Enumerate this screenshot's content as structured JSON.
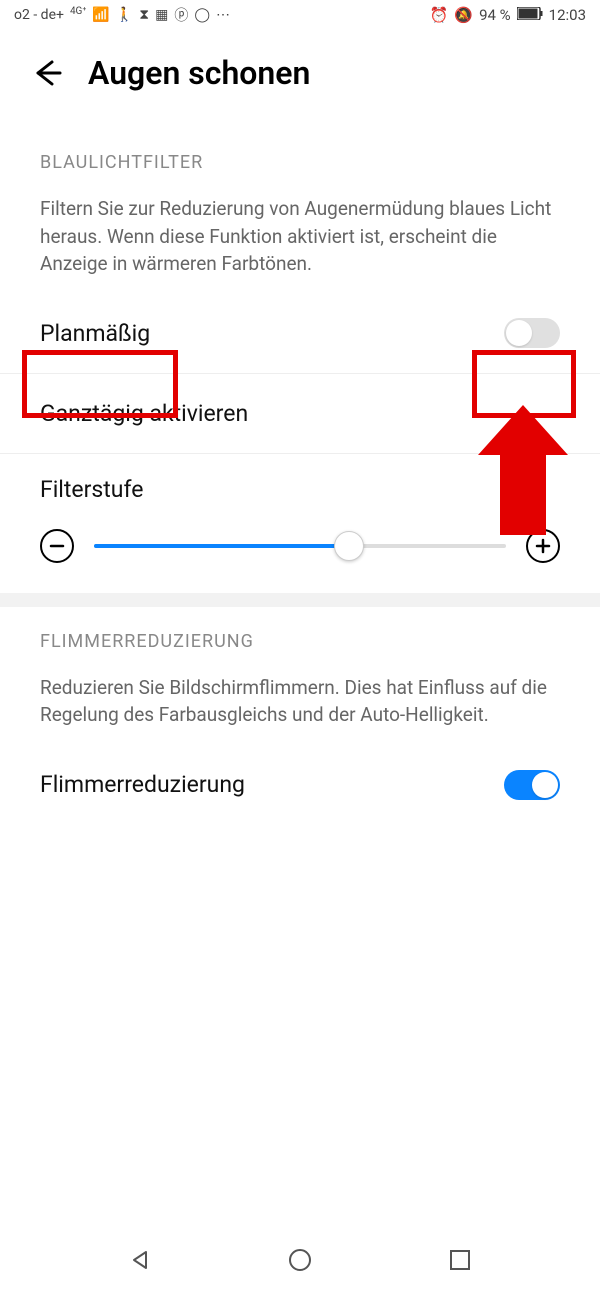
{
  "status": {
    "carrier": "o2 - de+",
    "net_tag": "4G⁺",
    "battery_text": "94 %",
    "time": "12:03"
  },
  "header": {
    "title": "Augen schonen"
  },
  "section1": {
    "heading": "BLAULICHTFILTER",
    "description": "Filtern Sie zur Reduzierung von Augenermüdung blaues Licht heraus. Wenn diese Funktion aktiviert ist, erscheint die Anzeige in wärmeren Farbtönen.",
    "scheduled_label": "Planmäßig",
    "allday_label": "Ganztägig aktivieren",
    "filter_level_label": "Filterstufe"
  },
  "section2": {
    "heading": "FLIMMERREDUZIERUNG",
    "description": "Reduzieren Sie Bildschirmflimmern. Dies hat Einfluss auf die Regelung des Farbausgleichs und der Auto-Helligkeit.",
    "flicker_label": "Flimmerreduzierung"
  }
}
